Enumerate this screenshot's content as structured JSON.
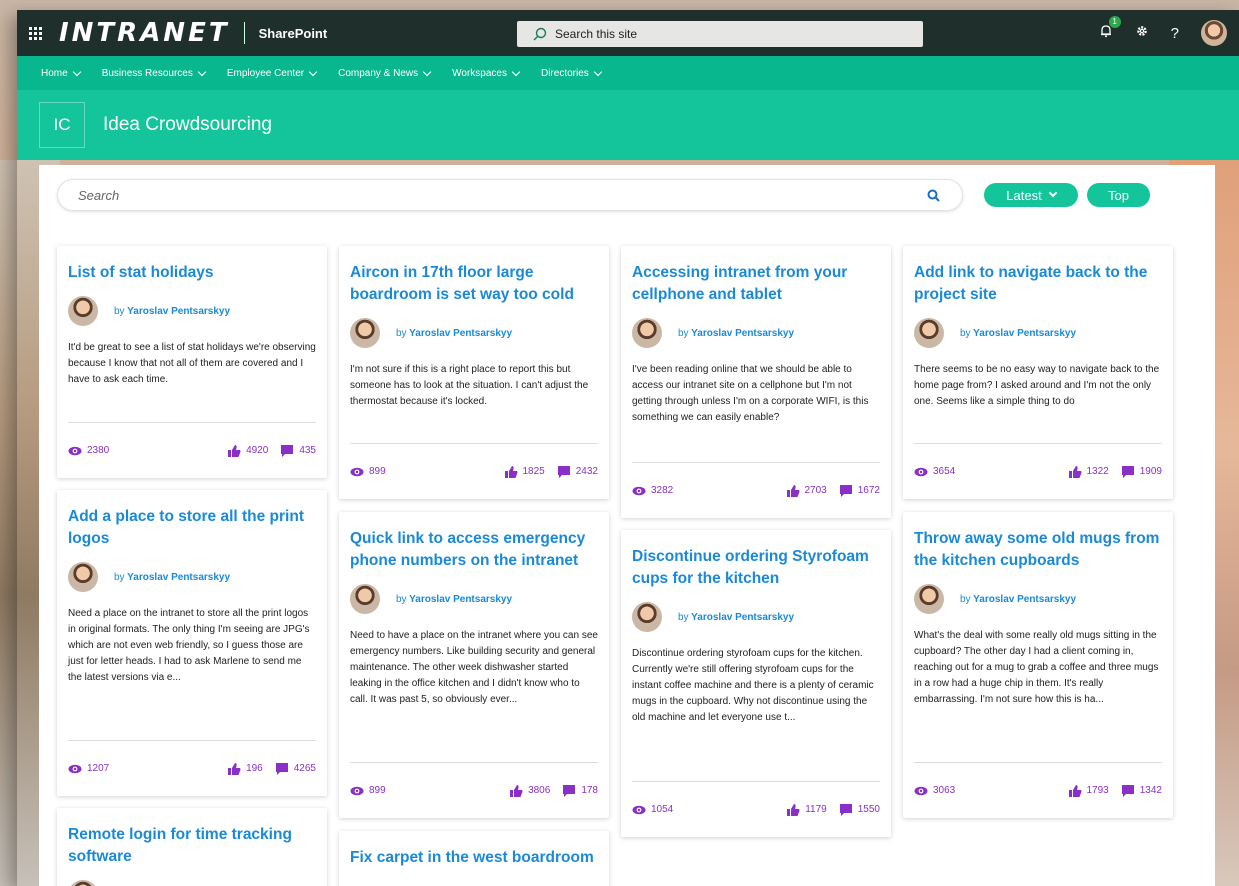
{
  "header": {
    "brand": "INTRANET",
    "product": "SharePoint",
    "site_search_placeholder": "Search this site",
    "notification_count": "1",
    "help_label": "?"
  },
  "nav": [
    {
      "label": "Home"
    },
    {
      "label": "Business Resources"
    },
    {
      "label": "Employee Center"
    },
    {
      "label": "Company & News"
    },
    {
      "label": "Workspaces"
    },
    {
      "label": "Directories"
    }
  ],
  "site": {
    "logo": "IC",
    "title": "Idea Crowdsourcing"
  },
  "toolbar": {
    "search_placeholder": "Search",
    "latest_label": "Latest",
    "top_label": "Top"
  },
  "cards": [
    {
      "title": "List of stat holidays",
      "author_prefix": "by",
      "author": "Yaroslav Pentsarskyy",
      "excerpt": "It'd be great to see a list of stat holidays we're observing because I know that not all of them are covered and I have to ask each time.",
      "views": "2380",
      "likes": "4920",
      "comments": "435"
    },
    {
      "title": "Aircon in 17th floor large boardroom is set way too cold",
      "author_prefix": "by",
      "author": "Yaroslav Pentsarskyy",
      "excerpt": "I'm not sure if this is a right place to report this but someone has to look at the situation. I can't adjust the thermostat because it's locked.",
      "views": "899",
      "likes": "1825",
      "comments": "2432"
    },
    {
      "title": "Accessing intranet from your cellphone and tablet",
      "author_prefix": "by",
      "author": "Yaroslav Pentsarskyy",
      "excerpt": "I've been reading online that we should be able to access our intranet site on a cellphone but I'm not getting through unless I'm on a corporate WIFI, is this something we can easily enable?",
      "views": "3282",
      "likes": "2703",
      "comments": "1672"
    },
    {
      "title": "Add link to navigate back to the project site",
      "author_prefix": "by",
      "author": "Yaroslav Pentsarskyy",
      "excerpt": "There seems to be no easy way to navigate back to the home page from? I asked around and I'm not the only one. Seems like a simple thing to do",
      "views": "3654",
      "likes": "1322",
      "comments": "1909"
    },
    {
      "title": "Add a place to store all the print logos",
      "author_prefix": "by",
      "author": "Yaroslav Pentsarskyy",
      "excerpt": "Need a place on the intranet to store all the print logos in original formats. The only thing I'm seeing are JPG's which are not even web friendly, so I guess those are just for letter heads. I had to ask Marlene to send me the latest versions via e...",
      "views": "1207",
      "likes": "196",
      "comments": "4265"
    },
    {
      "title": "Quick link to access emergency phone numbers on the intranet",
      "author_prefix": "by",
      "author": "Yaroslav Pentsarskyy",
      "excerpt": "Need to have a place on the intranet where you can see emergency numbers. Like building security and general maintenance. The other week dishwasher started leaking in the office kitchen and I didn't know who to call. It was past 5, so obviously ever...",
      "views": "899",
      "likes": "3806",
      "comments": "178"
    },
    {
      "title": "Discontinue ordering Styrofoam cups for the kitchen",
      "author_prefix": "by",
      "author": "Yaroslav Pentsarskyy",
      "excerpt": "Discontinue ordering styrofoam cups for the kitchen. Currently we're still offering styrofoam cups for the instant coffee machine and there is a plenty of ceramic mugs in the cupboard. Why not discontinue using the old machine and let everyone use t...",
      "views": "1054",
      "likes": "1179",
      "comments": "1550"
    },
    {
      "title": "Throw away some old mugs from the kitchen cupboards",
      "author_prefix": "by",
      "author": "Yaroslav Pentsarskyy",
      "excerpt": "What's the deal with some really old mugs sitting in the cupboard? The other day I had a client coming in, reaching out for a mug to grab a coffee and three mugs in a row had a huge chip in them. It's really embarrassing. I'm not sure how this is ha...",
      "views": "3063",
      "likes": "1793",
      "comments": "1342"
    },
    {
      "title": "Remote login for time tracking software"
    },
    {
      "title": "Fix carpet in the west boardroom"
    }
  ],
  "colors": {
    "topbar": "#1f2f2c",
    "nav": "#08b78d",
    "header": "#14c59b",
    "title_blue": "#1a8ad8",
    "stat_purple": "#8b2fc9"
  }
}
